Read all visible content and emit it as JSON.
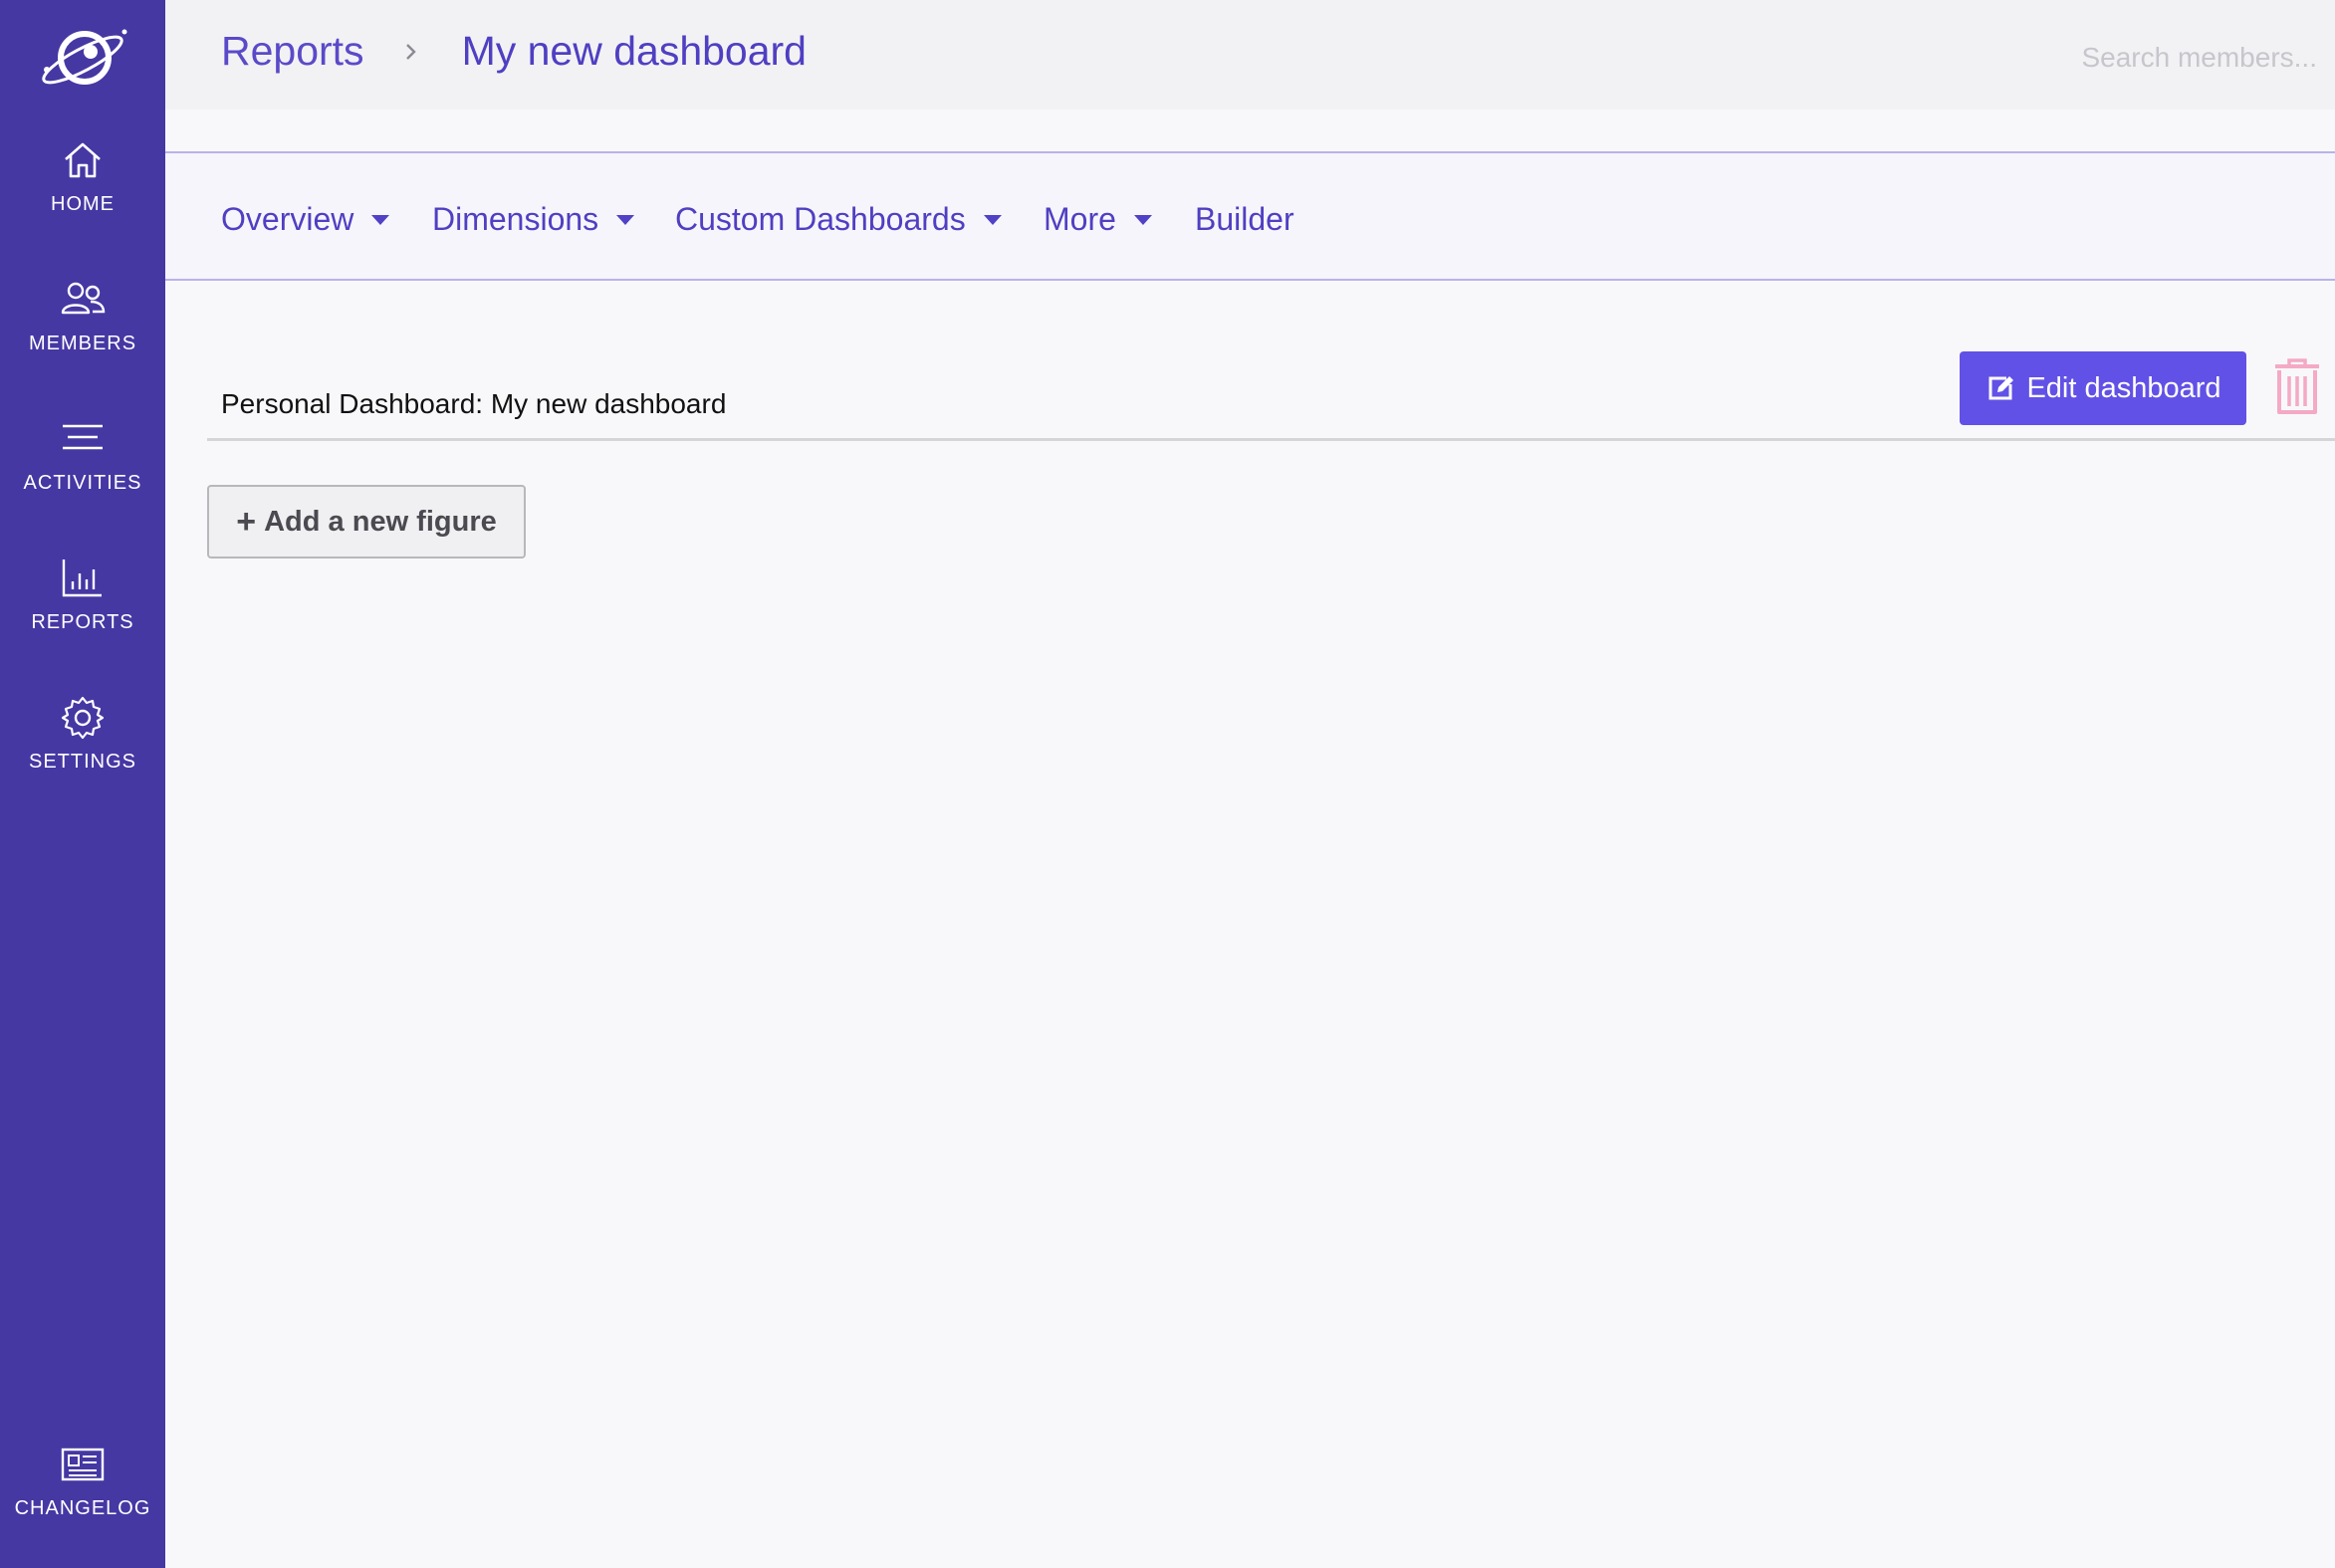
{
  "sidebar": {
    "logo_icon": "planet-orbit-logo",
    "items": [
      {
        "label": "HOME",
        "icon": "home-icon"
      },
      {
        "label": "MEMBERS",
        "icon": "members-icon"
      },
      {
        "label": "ACTIVITIES",
        "icon": "activities-icon"
      },
      {
        "label": "REPORTS",
        "icon": "reports-icon"
      },
      {
        "label": "SETTINGS",
        "icon": "settings-icon"
      }
    ],
    "footer": {
      "label": "CHANGELOG",
      "icon": "newspaper-icon"
    },
    "background": "#4538a3"
  },
  "header": {
    "breadcrumb": {
      "parent": "Reports",
      "current": "My new dashboard"
    },
    "search": {
      "placeholder": "Search members..."
    }
  },
  "tabs": [
    {
      "label": "Overview",
      "has_dropdown": true
    },
    {
      "label": "Dimensions",
      "has_dropdown": true
    },
    {
      "label": "Custom Dashboards",
      "has_dropdown": true
    },
    {
      "label": "More",
      "has_dropdown": true
    },
    {
      "label": "Builder",
      "has_dropdown": false
    }
  ],
  "main": {
    "dashboard_title": "Personal Dashboard: My new dashboard",
    "edit_button": "Edit dashboard",
    "add_figure_button": "Add a new figure"
  },
  "colors": {
    "accent": "#6251e6",
    "link": "#4f3fc2",
    "danger": "#f4a9c4"
  }
}
